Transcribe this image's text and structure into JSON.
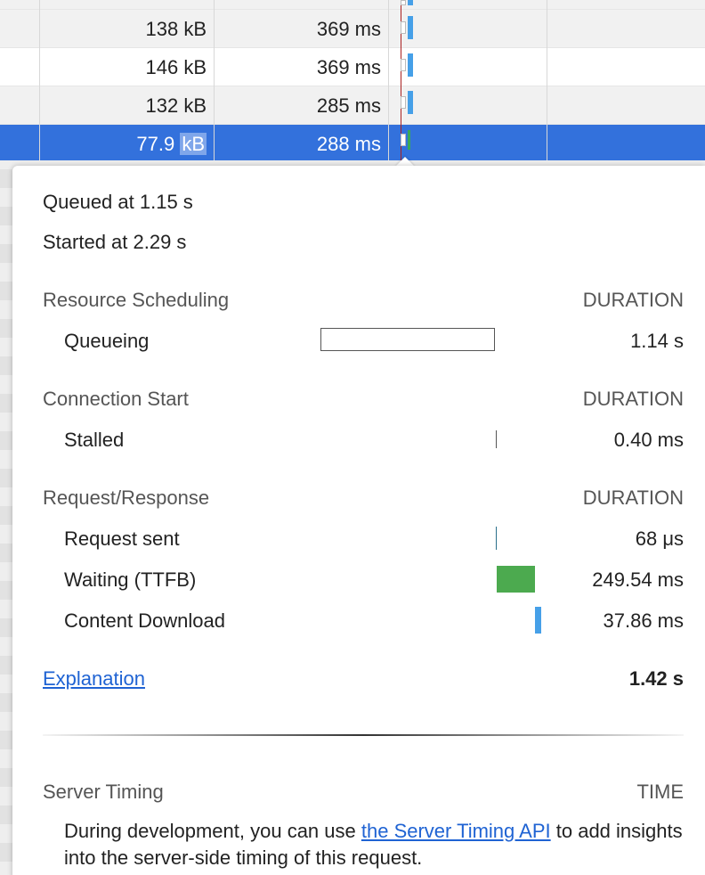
{
  "network_rows": [
    {
      "size_value": "138 kB",
      "time": "369 ms"
    },
    {
      "size_value": "146 kB",
      "time": "369 ms"
    },
    {
      "size_value": "132 kB",
      "time": "285 ms"
    },
    {
      "size_number": "77.9",
      "size_unit": "kB",
      "time": "288 ms"
    }
  ],
  "timing": {
    "queued_at": "Queued at 1.15 s",
    "started_at": "Started at 2.29 s",
    "sections": [
      {
        "title": "Resource Scheduling",
        "header": "DURATION",
        "rows": [
          {
            "label": "Queueing",
            "value": "1.14 s"
          }
        ]
      },
      {
        "title": "Connection Start",
        "header": "DURATION",
        "rows": [
          {
            "label": "Stalled",
            "value": "0.40 ms"
          }
        ]
      },
      {
        "title": "Request/Response",
        "header": "DURATION",
        "rows": [
          {
            "label": "Request sent",
            "value": "68 μs"
          },
          {
            "label": "Waiting (TTFB)",
            "value": "249.54 ms"
          },
          {
            "label": "Content Download",
            "value": "37.86 ms"
          }
        ]
      }
    ],
    "explanation_link": "Explanation",
    "total": "1.42 s"
  },
  "server_timing": {
    "title": "Server Timing",
    "header": "TIME",
    "text_before": "During development, you can use ",
    "link": "the Server Timing API",
    "text_after": " to add insights into the server-side timing of this request."
  },
  "colors": {
    "selected_row": "#3371dc",
    "waiting_bar": "#4caa4f",
    "download_bar": "#46a0e8",
    "link": "#1f63d3"
  }
}
